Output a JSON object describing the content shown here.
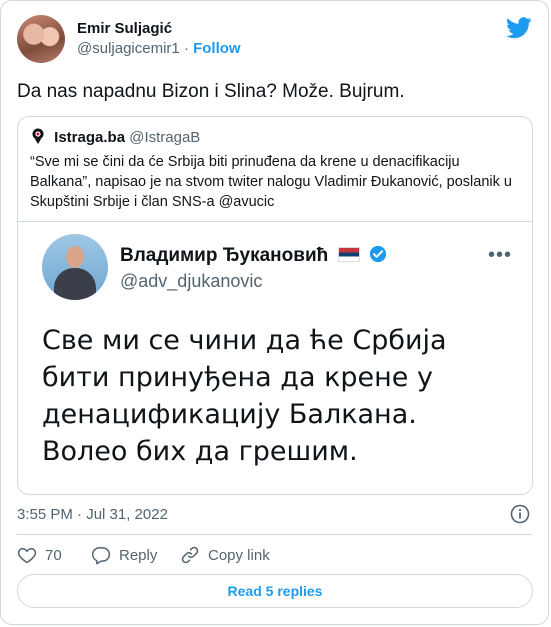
{
  "tweet": {
    "author": {
      "display_name": "Emir Suljagić",
      "handle": "@suljagicemir1",
      "follow_label": "Follow"
    },
    "text": "Da nas napadnu Bizon i Slina? Može. Bujrum.",
    "timestamp": "3:55 PM · Jul 31, 2022",
    "likes": "70",
    "reply_label": "Reply",
    "copy_link_label": "Copy link",
    "read_replies_label": "Read 5 replies"
  },
  "quote": {
    "author_name": "Istraga.ba",
    "author_handle": "@IstragaB",
    "text": "“Sve mi se čini da će Srbija biti prinuđena da krene u denacifikaciju Balkana”, napisao je na stvom twiter nalogu Vladimir Đukanović, poslanik u Skupštini Srbije i član SNS-a @avucic",
    "image": {
      "author_name": "Владимир Ђукановић",
      "author_handle": "@adv_djukanovic",
      "more_label": "•••",
      "text": "Све ми се чини да ће Србија бити принуђена да крене у денацификацију Балкана. Волео бих да грешим."
    }
  },
  "colors": {
    "accent": "#1d9bf0",
    "muted": "#536471",
    "border": "#cfd9de"
  },
  "icons": [
    "twitter-bird-icon",
    "istraga-logo-icon",
    "verified-icon",
    "info-icon",
    "heart-icon",
    "reply-icon",
    "link-icon"
  ]
}
